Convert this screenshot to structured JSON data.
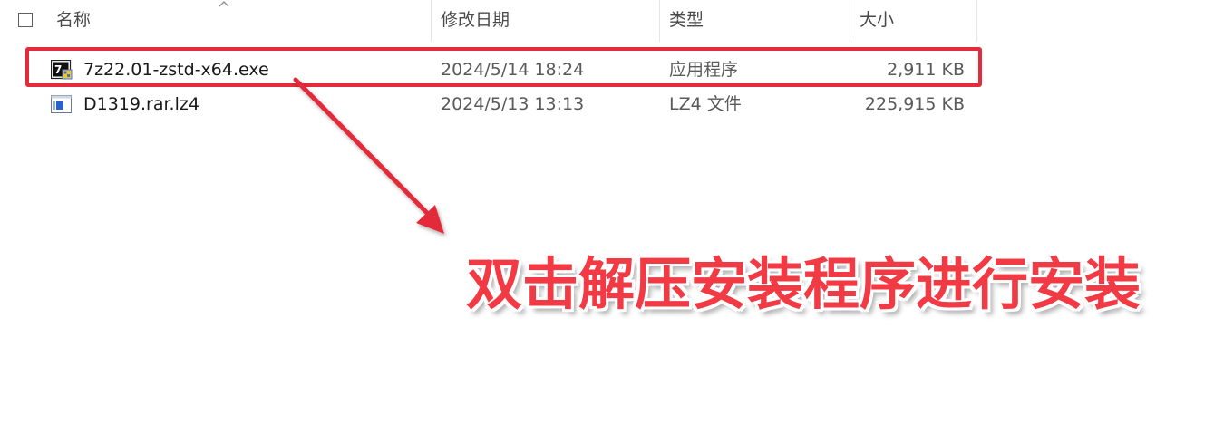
{
  "columns": {
    "name": "名称",
    "date_modified": "修改日期",
    "type": "类型",
    "size": "大小"
  },
  "files": [
    {
      "name": "7z22.01-zstd-x64.exe",
      "date_modified": "2024/5/14 18:24",
      "type": "应用程序",
      "size": "2,911 KB",
      "icon": "7zip-exe-icon",
      "highlighted": true
    },
    {
      "name": "D1319.rar.lz4",
      "date_modified": "2024/5/13 13:13",
      "type": "LZ4 文件",
      "size": "225,915 KB",
      "icon": "lz4-file-icon",
      "highlighted": false
    }
  ],
  "annotation": {
    "text": "双击解压安装程序进行安装",
    "color": "#f23a44"
  },
  "colors": {
    "highlight_border": "#e32b3a",
    "arrow": "#e32b3a"
  }
}
